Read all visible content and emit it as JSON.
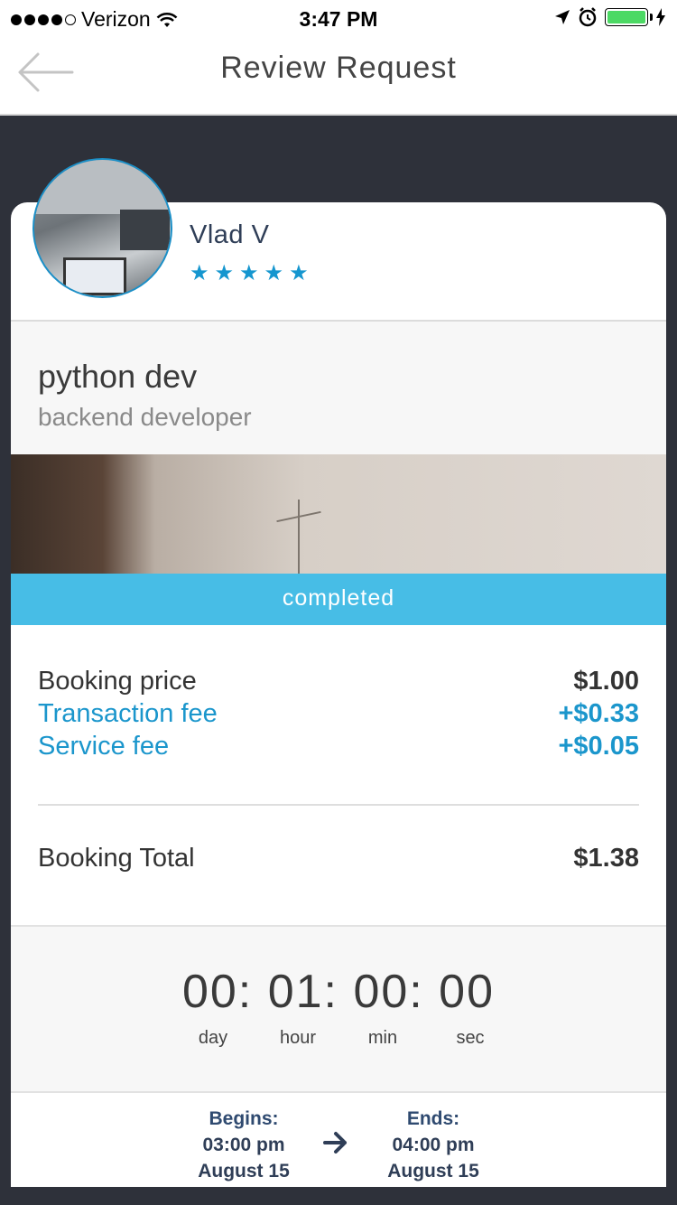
{
  "status_bar": {
    "carrier": "Verizon",
    "time": "3:47 PM",
    "signal_bars": 4,
    "battery_level": 1.0
  },
  "nav": {
    "title": "Review Request",
    "back_icon": "arrow-left-icon"
  },
  "profile": {
    "name": "Vlad V",
    "rating": 5,
    "star_glyph": "★"
  },
  "job": {
    "title": "python dev",
    "subtitle": "backend developer"
  },
  "status": {
    "label": "completed",
    "color": "#47bde6"
  },
  "pricing": {
    "booking_price_label": "Booking price",
    "booking_price_value": "$1.00",
    "transaction_fee_label": "Transaction fee",
    "transaction_fee_value": "+$0.33",
    "service_fee_label": "Service fee",
    "service_fee_value": "+$0.05",
    "total_label": "Booking Total",
    "total_value": "$1.38"
  },
  "timer": {
    "display": "00: 01: 00: 00",
    "labels": [
      "day",
      "hour",
      "min",
      "sec"
    ]
  },
  "schedule": {
    "begins_label": "Begins:",
    "begins_time": "03:00 pm",
    "begins_date": "August 15",
    "ends_label": "Ends:",
    "ends_time": "04:00 pm",
    "ends_date": "August 15"
  },
  "colors": {
    "accent": "#1b96cc",
    "background": "#2e313a",
    "heading": "#2f3e57"
  }
}
